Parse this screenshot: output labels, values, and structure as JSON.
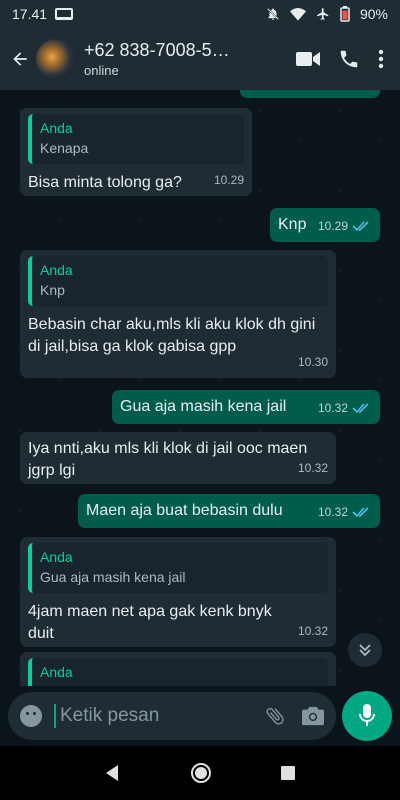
{
  "status_bar": {
    "time": "17.41",
    "battery": "90%"
  },
  "header": {
    "contact_name": "+62 838-7008-5…",
    "status": "online"
  },
  "messages": [
    {
      "direction": "in",
      "quote_author": "Anda",
      "quote_text": "Kenapa",
      "text": "Bisa minta tolong ga?",
      "time": "10.29"
    },
    {
      "direction": "out",
      "text": "Knp",
      "time": "10.29",
      "read": true
    },
    {
      "direction": "in",
      "quote_author": "Anda",
      "quote_text": "Knp",
      "text": "Bebasin char aku,mls kli aku klok dh gini di jail,bisa ga klok gabisa gpp",
      "time": "10.30"
    },
    {
      "direction": "out",
      "text": "Gua aja masih kena jail",
      "time": "10.32",
      "read": true
    },
    {
      "direction": "in",
      "text": "Iya nnti,aku mls kli klok di jail ooc maen jgrp lgi",
      "time": "10.32"
    },
    {
      "direction": "out",
      "text": "Maen aja buat bebasin dulu",
      "time": "10.32",
      "read": true
    },
    {
      "direction": "in",
      "quote_author": "Anda",
      "quote_text": "Gua aja masih kena jail",
      "text": "4jam maen net apa gak kenk bnyk duit",
      "time": "10.32"
    },
    {
      "direction": "in",
      "quote_author": "Anda"
    }
  ],
  "composer": {
    "placeholder": "Ketik pesan"
  },
  "colors": {
    "accent": "#00a884",
    "incoming_bubble": "#1f2c33",
    "outgoing_bubble": "#005c4b",
    "read_ticks": "#53bdeb"
  }
}
